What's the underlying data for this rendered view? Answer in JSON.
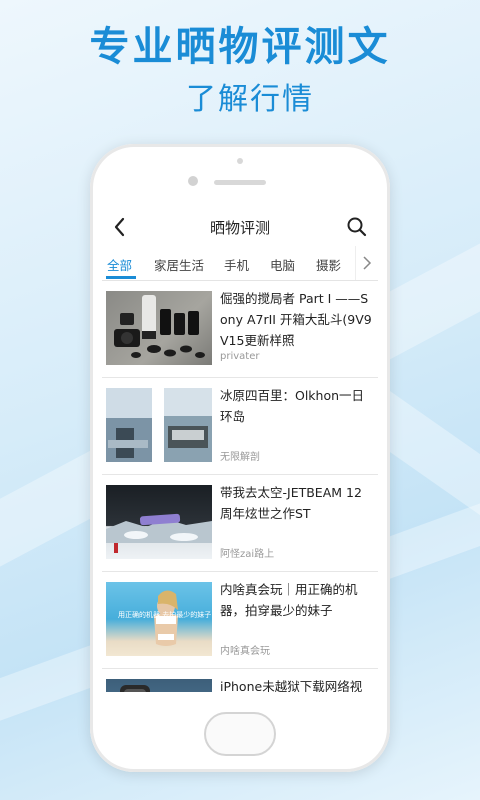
{
  "promo": {
    "title": "专业晒物评测文",
    "subtitle": "了解行情"
  },
  "app": {
    "nav_title": "晒物评测",
    "tabs": [
      {
        "label": "全部",
        "active": true
      },
      {
        "label": "家居生活",
        "active": false
      },
      {
        "label": "手机",
        "active": false
      },
      {
        "label": "电脑",
        "active": false
      },
      {
        "label": "摄影",
        "active": false
      }
    ],
    "articles": [
      {
        "title": "倔强的搅局者 Part I ——Sony A7rII 开箱大乱斗(9V9V15更新样照",
        "source": "privater",
        "thumb": "camera-lenses"
      },
      {
        "title": "冰原四百里：Olkhon一日环岛",
        "source": "无限解剖",
        "thumb": "ice-lake"
      },
      {
        "title": "带我去太空-JETBEAM 12周年炫世之作ST",
        "source": "阿怪zai路上",
        "thumb": "flashlight-on-ice"
      },
      {
        "title": "内啥真会玩｜用正确的机器，拍穿最少的妹子",
        "source": "内啥真会玩",
        "thumb": "beach-photo",
        "thumb_caption": "用正确的机器 去拍最少的妹子"
      },
      {
        "title": "iPhone未越狱下载网络视",
        "source": "",
        "thumb": "phone-screen"
      }
    ]
  },
  "colors": {
    "accent": "#1a8cd6",
    "text": "#222222",
    "muted": "#999999"
  }
}
